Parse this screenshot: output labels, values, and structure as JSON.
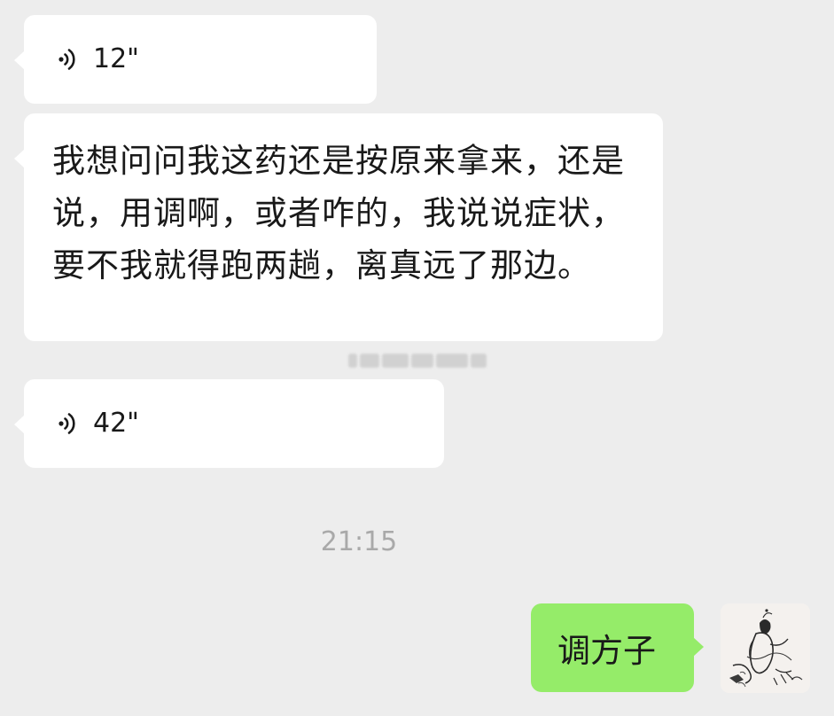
{
  "messages": {
    "voice1": {
      "duration": "12\"",
      "icon": "voice-wave-icon"
    },
    "text1": {
      "text": "我想问问我这药还是按原来拿来，还是说，用调啊，或者咋的，我说说症状，要不我就得跑两趟，离真远了那边。"
    },
    "voice2": {
      "duration": "42\"",
      "icon": "voice-wave-icon"
    }
  },
  "timestamp": "21:15",
  "outgoing": {
    "text": "调方子"
  },
  "colors": {
    "background": "#ededed",
    "incoming_bubble": "#ffffff",
    "outgoing_bubble": "#95ec69",
    "timestamp_text": "#a9a9a9"
  }
}
